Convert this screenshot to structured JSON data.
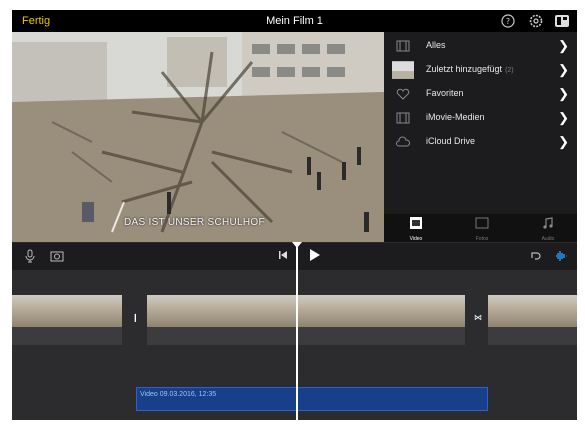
{
  "header": {
    "done_label": "Fertig",
    "title": "Mein Film 1"
  },
  "preview": {
    "caption": "DAS IST UNSER SCHULHOF"
  },
  "browser": {
    "items": [
      {
        "label": "Alles",
        "icon": "film-icon"
      },
      {
        "label": "Zuletzt hinzugefügt",
        "count": "(2)",
        "icon": "recent-thumbnail"
      },
      {
        "label": "Favoriten",
        "icon": "heart-icon"
      },
      {
        "label": "iMovie-Medien",
        "icon": "film-icon"
      },
      {
        "label": "iCloud Drive",
        "icon": "cloud-icon"
      }
    ],
    "tabs": [
      {
        "label": "Video",
        "active": true
      },
      {
        "label": "Fotos",
        "active": false
      },
      {
        "label": "Audio",
        "active": false
      }
    ]
  },
  "timeline": {
    "audio_clip_label": "Video 09.03.2016, 12:35"
  },
  "colors": {
    "accent": "#f0c400",
    "toolbar_active": "#2a9df4",
    "audio_clip": "#173f8a"
  }
}
